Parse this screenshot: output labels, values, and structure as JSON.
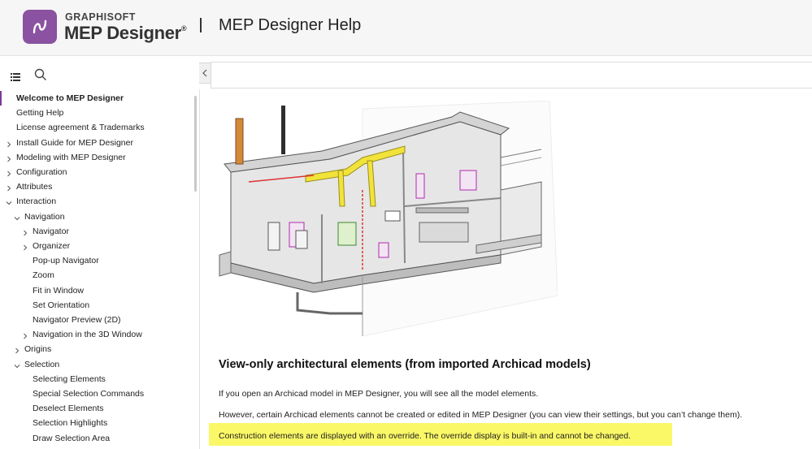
{
  "header": {
    "brand_top": "GRAPHISOFT",
    "brand_main": "MEP Designer",
    "brand_reg": "®",
    "title": "MEP Designer Help"
  },
  "sidebar": {
    "items": [
      {
        "label": "Welcome to MEP Designer",
        "level": 0,
        "chevron": "none",
        "active": true
      },
      {
        "label": "Getting Help",
        "level": 0,
        "chevron": "none"
      },
      {
        "label": "License agreement & Trademarks",
        "level": 0,
        "chevron": "none"
      },
      {
        "label": "Install Guide for MEP Designer",
        "level": 0,
        "chevron": "right"
      },
      {
        "label": "Modeling with MEP Designer",
        "level": 0,
        "chevron": "right"
      },
      {
        "label": "Configuration",
        "level": 0,
        "chevron": "right"
      },
      {
        "label": "Attributes",
        "level": 0,
        "chevron": "right"
      },
      {
        "label": "Interaction",
        "level": 0,
        "chevron": "down"
      },
      {
        "label": "Navigation",
        "level": 1,
        "chevron": "down"
      },
      {
        "label": "Navigator",
        "level": 2,
        "chevron": "right"
      },
      {
        "label": "Organizer",
        "level": 2,
        "chevron": "right"
      },
      {
        "label": "Pop-up Navigator",
        "level": 2,
        "chevron": "none"
      },
      {
        "label": "Zoom",
        "level": 2,
        "chevron": "none"
      },
      {
        "label": "Fit in Window",
        "level": 2,
        "chevron": "none"
      },
      {
        "label": "Set Orientation",
        "level": 2,
        "chevron": "none"
      },
      {
        "label": "Navigator Preview (2D)",
        "level": 2,
        "chevron": "none"
      },
      {
        "label": "Navigation in the 3D Window",
        "level": 2,
        "chevron": "right"
      },
      {
        "label": "Origins",
        "level": 1,
        "chevron": "right"
      },
      {
        "label": "Selection",
        "level": 1,
        "chevron": "down"
      },
      {
        "label": "Selecting Elements",
        "level": 2,
        "chevron": "none"
      },
      {
        "label": "Special Selection Commands",
        "level": 2,
        "chevron": "none"
      },
      {
        "label": "Deselect Elements",
        "level": 2,
        "chevron": "none"
      },
      {
        "label": "Selection Highlights",
        "level": 2,
        "chevron": "none"
      },
      {
        "label": "Draw Selection Area",
        "level": 2,
        "chevron": "none"
      }
    ]
  },
  "content": {
    "heading": "View-only architectural elements (from imported Archicad models)",
    "para1": "If you open an Archicad model in MEP Designer, you will see all the model elements.",
    "para2": "However, certain Archicad elements cannot be created or edited in MEP Designer (you can view their settings, but you can’t change them).",
    "para3": "Construction elements are displayed with an override. The override display is built-in and cannot be changed.",
    "highlight_color": "#faf866"
  },
  "colors": {
    "brand": "#8b52a1",
    "active_marker": "#7c3a95"
  }
}
